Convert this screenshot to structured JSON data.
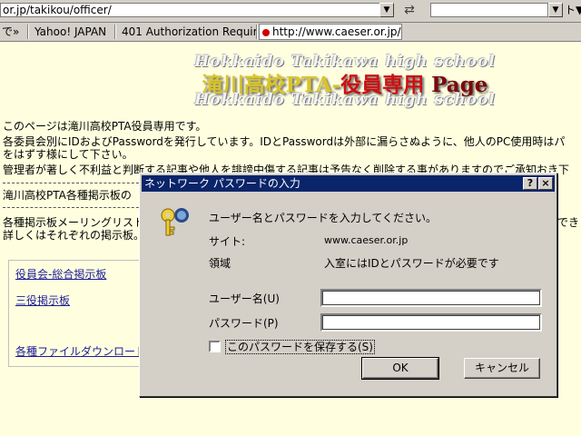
{
  "browser": {
    "address": "or.jp/takikou/officer/",
    "search_value": "",
    "search_tail": "ト▼",
    "links_prefix": "で»",
    "links": [
      "Yahoo! JAPAN",
      "401 Authorization Required"
    ],
    "active_tab": "http://www.caeser.or.jp/ta..."
  },
  "page": {
    "banner_sub_top": "Hokkaido Takikawa high school",
    "banner_title_a": "滝川高校PTA-",
    "banner_title_b": "役員専用",
    "banner_title_c": " Page",
    "banner_sub_bottom": "Hokkaido Takikawa high school",
    "lines": [
      "このページは滝川高校PTA役員専用です。",
      "各委員会別にIDおよびPasswordを発行しています。IDとPasswordは外部に漏らさぬように、他人のPC使用時はパ",
      "をはずす様にして下さい。",
      "管理者が著しく不利益と判断する記事や他人を誹謗中傷する記事は予告なく削除する事がありますのでご承知おき下",
      "滝川高校PTA各種掲示板の",
      "各種掲示板メーリングリスト",
      "詳しくはそれぞれの掲示板。"
    ],
    "line_right_tail": "でき",
    "links": [
      "役員会-総合掲示板",
      "三役掲示板",
      "各種ファイルダウンロード"
    ]
  },
  "dialog": {
    "title": "ネットワーク パスワードの入力",
    "help_btn": "?",
    "close_btn": "×",
    "prompt": "ユーザー名とパスワードを入力してください。",
    "site_label": "サイト:",
    "site_value": "www.caeser.or.jp",
    "realm_label": "領域",
    "realm_value": "入室にはIDとパスワードが必要です",
    "username_label": "ユーザー名(U)",
    "username_value": "",
    "password_label": "パスワード(P)",
    "password_value": "",
    "save_label": "このパスワードを保存する(S)",
    "ok": "OK",
    "cancel": "キャンセル"
  },
  "colors": {
    "page_bg": "#ffffe0",
    "titlebar": "#0a246a",
    "dialog_face": "#d4d0c8",
    "link": "#1b1b9a"
  }
}
